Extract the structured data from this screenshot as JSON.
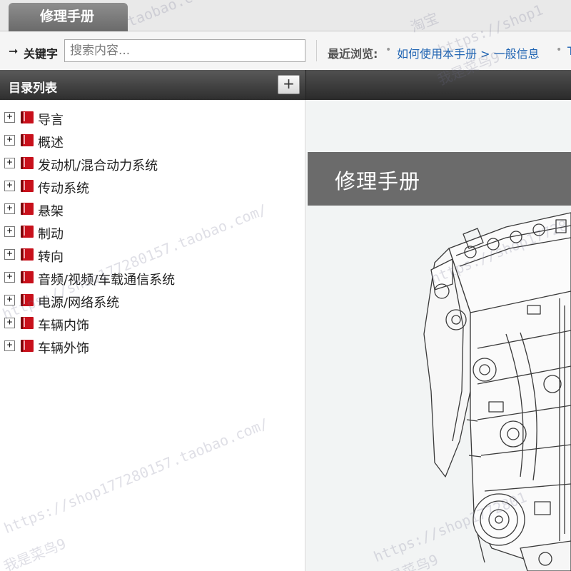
{
  "tab": {
    "title": "修理手册"
  },
  "search": {
    "arrow_icon": "arrow-right-icon",
    "keyword_label": "关键字",
    "placeholder": "搜索内容..."
  },
  "recent": {
    "label": "最近浏览:",
    "items": [
      {
        "text": "如何使用本手册 > 一般信息"
      },
      {
        "text": "T"
      }
    ]
  },
  "sidebar": {
    "title": "目录列表",
    "add_button": "+",
    "items": [
      {
        "label": "导言",
        "expander": "+"
      },
      {
        "label": "概述",
        "expander": "+"
      },
      {
        "label": "发动机/混合动力系统",
        "expander": "+"
      },
      {
        "label": "传动系统",
        "expander": "+"
      },
      {
        "label": "悬架",
        "expander": "+"
      },
      {
        "label": "制动",
        "expander": "+"
      },
      {
        "label": "转向",
        "expander": "+"
      },
      {
        "label": "音频/视频/车载通信系统",
        "expander": "+"
      },
      {
        "label": "电源/网络系统",
        "expander": "+"
      },
      {
        "label": "车辆内饰",
        "expander": "+"
      },
      {
        "label": "车辆外饰",
        "expander": "+"
      }
    ]
  },
  "main": {
    "banner_title": "修理手册"
  },
  "watermarks": [
    "taobao.com/",
    "淘宝",
    "https://shop1",
    "我是菜鸟9",
    "https://shop177280157.taobao.com/",
    "https://shop17728",
    "我是菜鸟9",
    "https://shop177280157.taobao.com/",
    "https://shop1772801",
    "是菜鸟9"
  ],
  "colors": {
    "link": "#1e63b2",
    "book_icon": "#c8101b",
    "banner": "#6b6b6b",
    "header_dark": "#2e2e2e"
  }
}
